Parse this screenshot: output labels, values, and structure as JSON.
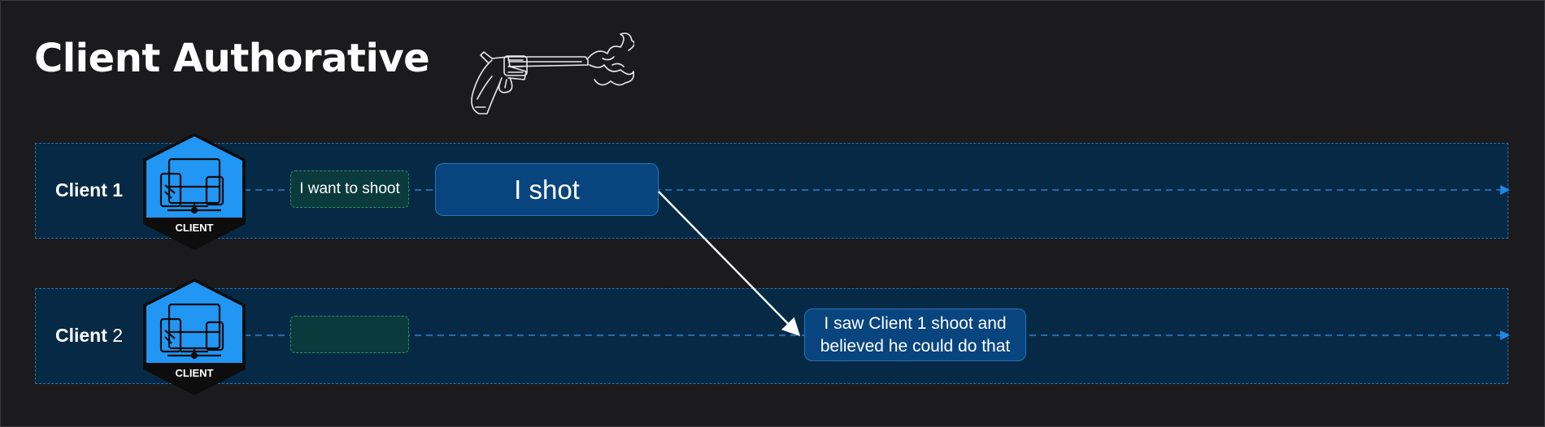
{
  "title": "Client Authorative",
  "lanes": [
    {
      "label_word": "Client",
      "label_num": "1",
      "badge": "CLIENT",
      "request_chip": "I want to shoot",
      "event": "I shot"
    },
    {
      "label_word": "Client",
      "label_num": "2",
      "badge": "CLIENT",
      "request_chip": "",
      "event_line1": "I saw Client 1 shoot and",
      "event_line2": "believed he could do that"
    }
  ],
  "colors": {
    "background": "#1b1b1d",
    "lane_fill": "#062a45",
    "lane_border": "#2c6da8",
    "event_fill": "#08457e",
    "chip_fill": "#0b3a3c",
    "chip_border": "#2d8a6d",
    "hex_blue": "#2196f3",
    "hex_dark": "#0d0d0d"
  },
  "icons": [
    "devices-icon",
    "revolver-illustration"
  ]
}
